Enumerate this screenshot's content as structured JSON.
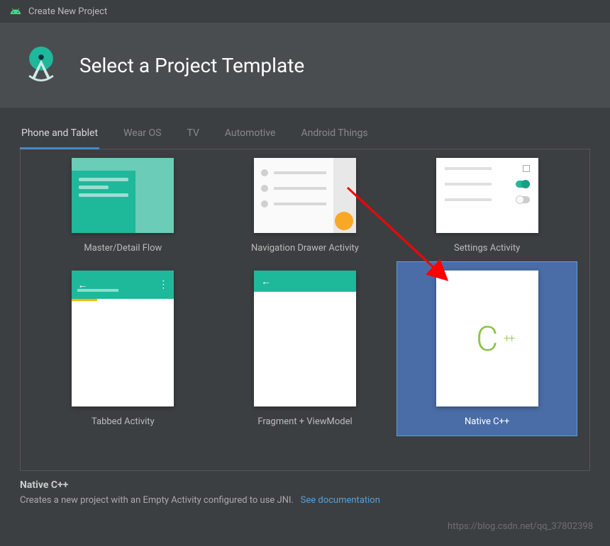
{
  "window": {
    "title": "Create New Project"
  },
  "header": {
    "title": "Select a Project Template"
  },
  "tabs": [
    {
      "label": "Phone and Tablet",
      "active": true
    },
    {
      "label": "Wear OS",
      "active": false
    },
    {
      "label": "TV",
      "active": false
    },
    {
      "label": "Automotive",
      "active": false
    },
    {
      "label": "Android Things",
      "active": false
    }
  ],
  "templates": [
    {
      "label": "Master/Detail Flow",
      "selected": false
    },
    {
      "label": "Navigation Drawer Activity",
      "selected": false
    },
    {
      "label": "Settings Activity",
      "selected": false
    },
    {
      "label": "Tabbed Activity",
      "selected": false
    },
    {
      "label": "Fragment + ViewModel",
      "selected": false
    },
    {
      "label": "Native C++",
      "selected": true
    }
  ],
  "footer": {
    "title": "Native C++",
    "description": "Creates a new project with an Empty Activity configured to use JNI.",
    "link_text": "See documentation"
  },
  "watermark": "https://blog.csdn.net/qq_37802398"
}
